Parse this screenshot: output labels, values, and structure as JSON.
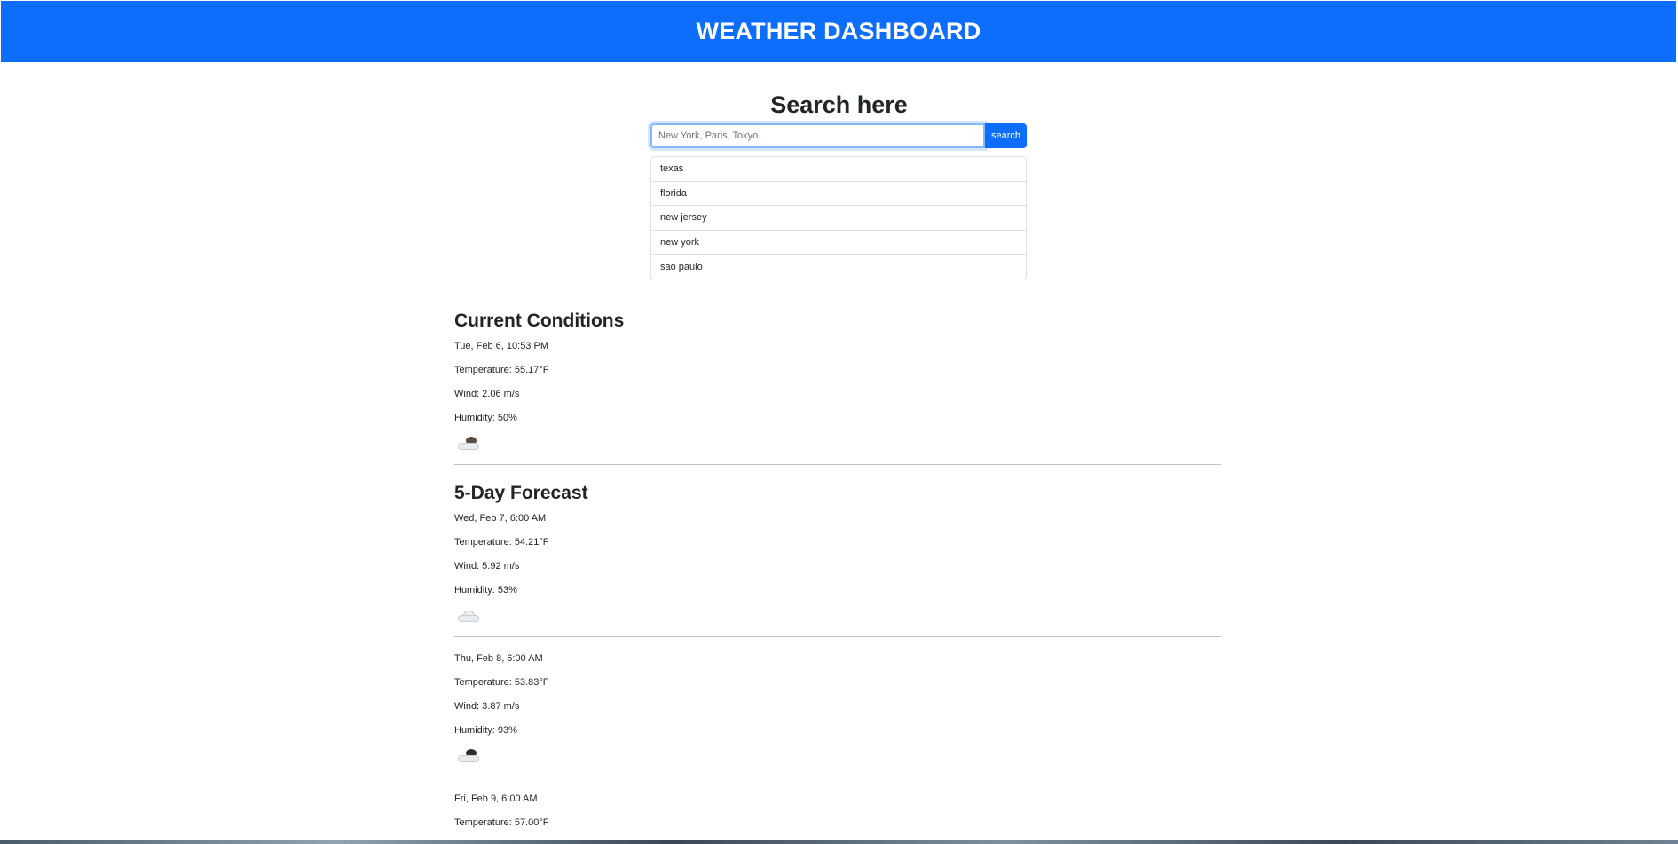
{
  "header": {
    "title": "WEATHER DASHBOARD"
  },
  "search": {
    "title": "Search here",
    "placeholder": "New York, Paris, Tokyo ...",
    "button_label": "search"
  },
  "history": [
    "texas",
    "florida",
    "new jersey",
    "new york",
    "sao paulo"
  ],
  "current": {
    "title": "Current Conditions",
    "date": "Tue, Feb 6, 10:53 PM",
    "temperature": "Temperature: 55.17°F",
    "wind": "Wind: 2.06 m/s",
    "humidity": "Humidity: 50%",
    "icon": "broken-clouds-icon"
  },
  "forecast": {
    "title": "5-Day Forecast",
    "days": [
      {
        "date": "Wed, Feb 7, 6:00 AM",
        "temperature": "Temperature: 54.21°F",
        "wind": "Wind: 5.92 m/s",
        "humidity": "Humidity: 53%",
        "icon": "cloud-icon"
      },
      {
        "date": "Thu, Feb 8, 6:00 AM",
        "temperature": "Temperature: 53.83°F",
        "wind": "Wind: 3.87 m/s",
        "humidity": "Humidity: 93%",
        "icon": "broken-clouds-icon"
      },
      {
        "date": "Fri, Feb 9, 6:00 AM",
        "temperature": "Temperature: 57.00°F"
      }
    ]
  }
}
